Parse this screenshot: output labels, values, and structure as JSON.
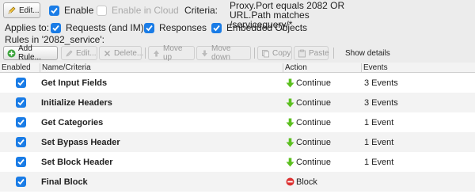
{
  "topbar": {
    "edit_label": "Edit...",
    "enable_label": "Enable",
    "enable_in_cloud_label": "Enable in Cloud",
    "criteria_label": "Criteria:",
    "criteria_text": "Proxy.Port equals 2082 OR URL.Path matches /servicequery/*"
  },
  "applies": {
    "label": "Applies to:",
    "requests_label": "Requests (and IM)",
    "responses_label": "Responses",
    "embedded_label": "Embedded Objects"
  },
  "rules_in_label": "Rules in '2082_service':",
  "toolbar": {
    "add_rule": "Add Rule...",
    "edit": "Edit...",
    "delete": "Delete...",
    "move_up": "Move up",
    "move_down": "Move down",
    "copy": "Copy",
    "paste": "Paste",
    "show_details": "Show details"
  },
  "table": {
    "headers": {
      "enabled": "Enabled",
      "name": "Name/Criteria",
      "action": "Action",
      "events": "Events"
    },
    "rows": [
      {
        "name": "Get Input Fields",
        "action": "Continue",
        "action_icon": "green-down-arrow-icon",
        "events": "3 Events"
      },
      {
        "name": "Initialize Headers",
        "action": "Continue",
        "action_icon": "green-down-arrow-icon",
        "events": "3 Events"
      },
      {
        "name": "Get Categories",
        "action": "Continue",
        "action_icon": "green-down-arrow-icon",
        "events": "1 Event"
      },
      {
        "name": "Set Bypass Header",
        "action": "Continue",
        "action_icon": "green-down-arrow-icon",
        "events": "1 Event"
      },
      {
        "name": "Set Block Header",
        "action": "Continue",
        "action_icon": "green-down-arrow-icon",
        "events": "1 Event"
      },
      {
        "name": "Final Block",
        "action": "Block",
        "action_icon": "red-stop-icon",
        "events": ""
      }
    ]
  },
  "colors": {
    "checkbox_blue": "#1a7ce6",
    "continue_green": "#5bbf1f",
    "block_red": "#d33"
  }
}
